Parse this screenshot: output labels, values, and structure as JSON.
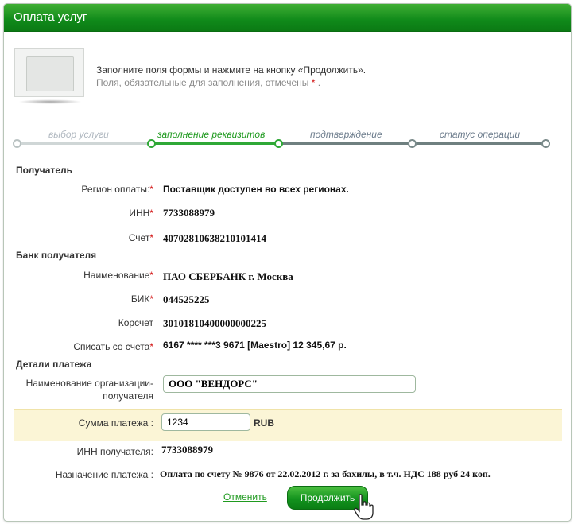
{
  "window": {
    "title": "Оплата услуг"
  },
  "intro": {
    "text": "Заполните поля формы и нажмите на кнопку «Продолжить».",
    "required_note": "Поля, обязательные для заполнения, отмечены",
    "star": "*",
    "dot": "."
  },
  "steps": [
    {
      "label": "выбор услуги",
      "state": "done"
    },
    {
      "label": "заполнение реквизитов",
      "state": "active"
    },
    {
      "label": "подтверждение",
      "state": "pending"
    },
    {
      "label": "статус операции",
      "state": "pending"
    }
  ],
  "recipient": {
    "heading": "Получатель",
    "region_label": "Регион оплаты:",
    "region_value": "Поставщик доступен во всех регионах.",
    "inn_label": "ИНН",
    "inn_value": "7733088979",
    "account_label": "Счет",
    "account_value": "40702810638210101414"
  },
  "bank": {
    "heading": "Банк получателя",
    "name_label": "Наименование",
    "name_value": "ПАО СБЕРБАНК г. Москва",
    "bik_label": "БИК",
    "bik_value": "044525225",
    "corr_label": "Корсчет",
    "corr_value": "30101810400000000225",
    "debit_label": "Списать со счета",
    "debit_value": "6167 **** ***3 9671  [Maestro] 12 345,67  р."
  },
  "payment": {
    "heading": "Детали платежа",
    "org_label_line1": "Наименование организации-",
    "org_label_line2": "получателя",
    "org_value": "ООО \"ВЕНДОРС\"",
    "amount_label": "Сумма платежа :",
    "amount_value": "1234",
    "currency": "RUB",
    "inn_label": "ИНН получателя:",
    "inn_value": "7733088979",
    "purpose_label": "Назначение платежа :",
    "purpose_value": "Оплата по счету № 9876 от 22.02.2012 г. за бахилы, в т.ч. НДС 188 руб 24 коп."
  },
  "actions": {
    "cancel_label": "Отменить",
    "continue_label": "Продолжить"
  },
  "colors": {
    "brand_green": "#108a1a",
    "required_star": "#d21010",
    "highlight_row": "#fbf5d6"
  }
}
